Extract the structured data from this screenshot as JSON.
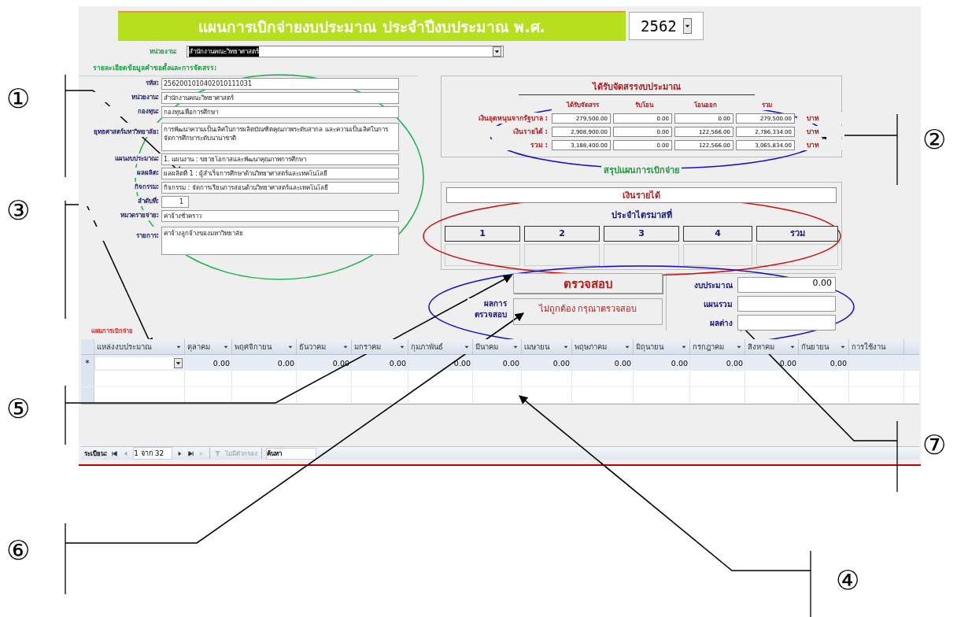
{
  "form": {
    "title": "แผนการเบิกจ่ายงบประมาณ ประจำปีงบประมาณ พ.ศ.",
    "year": "2562",
    "unit_label": "หน่วยงาน:",
    "unit_value": "สำนักงานคณะวิทยาศาสตร์",
    "details_heading": "รายละเอียดข้อมูลคำขอตั้งและการจัดสรร:",
    "details": [
      {
        "label": "รหัส:",
        "value": "2562001010402010111031",
        "kind": "line"
      },
      {
        "label": "หน่วยงาน:",
        "value": "สำนักงานคณะวิทยาศาสตร์",
        "kind": "line"
      },
      {
        "label": "กองทุน:",
        "value": "กองทุนเพื่อการศึกษา",
        "kind": "line"
      },
      {
        "label": "ยุทธศาสตร์มหาวิทยาลัย:",
        "value": "การพัฒนาความเป็นเลิศในการผลิตบัณฑิตคุณภาพระดับสากล และความเป็นเลิศในการจัดการศึกษาระดับนานาชาติ",
        "kind": "area"
      },
      {
        "label": "แผนงบประมาณ:",
        "value": "1. แผนงาน : ขยายโอกาสและพัฒนาคุณภาพการศึกษา",
        "kind": "line"
      },
      {
        "label": "ผลผลิต:",
        "value": "ผลผลิตที่ 1 : ผู้สำเร็จการศึกษาด้านวิทยาศาสตร์และเทคโนโลยี",
        "kind": "line"
      },
      {
        "label": "กิจกรรม:",
        "value": "กิจกรรม : จัดการเรียนการสอนด้านวิทยาศาสตร์และเทคโนโลยี",
        "kind": "line"
      },
      {
        "label": "ลำดับที่:",
        "value": "1",
        "kind": "short"
      },
      {
        "label": "หมวดรายจ่าย:",
        "value": "ค่าจ้างชั่วคราว",
        "kind": "line"
      },
      {
        "label": "รายการ:",
        "value": "ค่าจ้างลูกจ้างของมหาวิทยาลัย",
        "kind": "area"
      }
    ]
  },
  "allocation": {
    "title": "ได้รับจัดสรรงบประมาณ",
    "columns": [
      "ได้รับจัดสรร",
      "รับโอน",
      "โอนออก",
      "รวม"
    ],
    "rows": [
      {
        "label": "เงินอุดหนุนจากรัฐบาล :",
        "values": [
          "279,500.00",
          "0.00",
          "0.00",
          "279,500.00"
        ],
        "unit": "บาท"
      },
      {
        "label": "เงินรายได้ :",
        "values": [
          "2,908,900.00",
          "0.00",
          "122,566.00",
          "2,786,334.00"
        ],
        "unit": "บาท"
      },
      {
        "label": "รวม :",
        "values": [
          "3,188,400.00",
          "0.00",
          "122,566.00",
          "3,065,834.00"
        ],
        "unit": "บาท"
      }
    ]
  },
  "summary": {
    "title": "สรุปแผนการเบิกจ่าย",
    "source": "เงินรายได้",
    "quarter_heading": "ประจำไตรมาสที่",
    "quarters": [
      "1",
      "2",
      "3",
      "4",
      "รวม"
    ]
  },
  "check": {
    "button": "ตรวจสอบ",
    "result_label": "ผลการตรวจสอบ",
    "result": "ไม่ถูกต้อง กรุณาตรวจสอบ",
    "totals": [
      {
        "label": "งบประมาณ",
        "value": "0.00"
      },
      {
        "label": "แผนรวม"
      },
      {
        "label": "ผลต่าง"
      }
    ]
  },
  "plan": {
    "heading": "แผนการเบิกจ่าย",
    "columns": [
      "แหล่งงบประมาณ",
      "ตุลาคม",
      "พฤศจิกายน",
      "ธันวาคม",
      "มกราคม",
      "กุมภาพันธ์",
      "มีนาคม",
      "เมษายน",
      "พฤษภาคม",
      "มิถุนายน",
      "กรกฎาคม",
      "สิงหาคม",
      "กันยายน",
      "การใช้งาน"
    ],
    "new_row_marker": "*",
    "new_row": [
      "0.00",
      "0.00",
      "0.00",
      "0.00",
      "0.00",
      "0.00",
      "0.00",
      "0.00",
      "0.00",
      "0.00",
      "0.00",
      "0.00"
    ]
  },
  "navigation": {
    "label": "ระเบียน:",
    "position": "1 จาก 32",
    "filter": "ไม่มีตัวกรอง",
    "search": "ค้นหา"
  },
  "callouts": [
    "①",
    "②",
    "③",
    "④",
    "⑤",
    "⑥",
    "⑦"
  ]
}
